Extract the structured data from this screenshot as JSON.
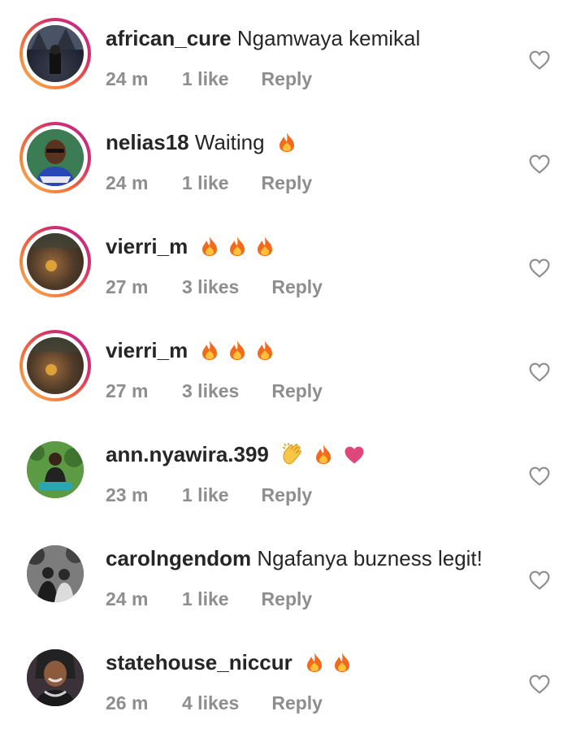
{
  "colors": {
    "story_ring": "#d62e6a",
    "meta_gray": "#8e8e8e",
    "fire": "#f26a1b",
    "heart_pink": "#e0457b"
  },
  "comments": [
    {
      "username": "african_cure",
      "text": " Ngamwaya kemikal",
      "time": "24 m",
      "likes": "1 like",
      "reply": "Reply",
      "emojis": [],
      "story": true,
      "avatar": "dark-outdoor"
    },
    {
      "username": "nelias18",
      "text": " Waiting",
      "time": "24 m",
      "likes": "1 like",
      "reply": "Reply",
      "emojis": [
        "fire"
      ],
      "story": true,
      "avatar": "woman-glasses"
    },
    {
      "username": "vierri_m",
      "text": "",
      "time": "27 m",
      "likes": "3 likes",
      "reply": "Reply",
      "emojis": [
        "fire",
        "fire",
        "fire"
      ],
      "story": true,
      "avatar": "dim-portrait"
    },
    {
      "username": "vierri_m",
      "text": "",
      "time": "27 m",
      "likes": "3 likes",
      "reply": "Reply",
      "emojis": [
        "fire",
        "fire",
        "fire"
      ],
      "story": true,
      "avatar": "dim-portrait"
    },
    {
      "username": "ann.nyawira.399",
      "text": "",
      "time": "23 m",
      "likes": "1 like",
      "reply": "Reply",
      "emojis": [
        "clap",
        "fire",
        "heart"
      ],
      "story": false,
      "avatar": "woman-garden"
    },
    {
      "username": "carolngendom",
      "text": " Ngafanya buzness legit!",
      "time": "24 m",
      "likes": "1 like",
      "reply": "Reply",
      "emojis": [],
      "story": false,
      "avatar": "bw-couple"
    },
    {
      "username": "statehouse_niccur",
      "text": "",
      "time": "26 m",
      "likes": "4 likes",
      "reply": "Reply",
      "emojis": [
        "fire",
        "fire"
      ],
      "story": false,
      "avatar": "woman-smile"
    }
  ]
}
